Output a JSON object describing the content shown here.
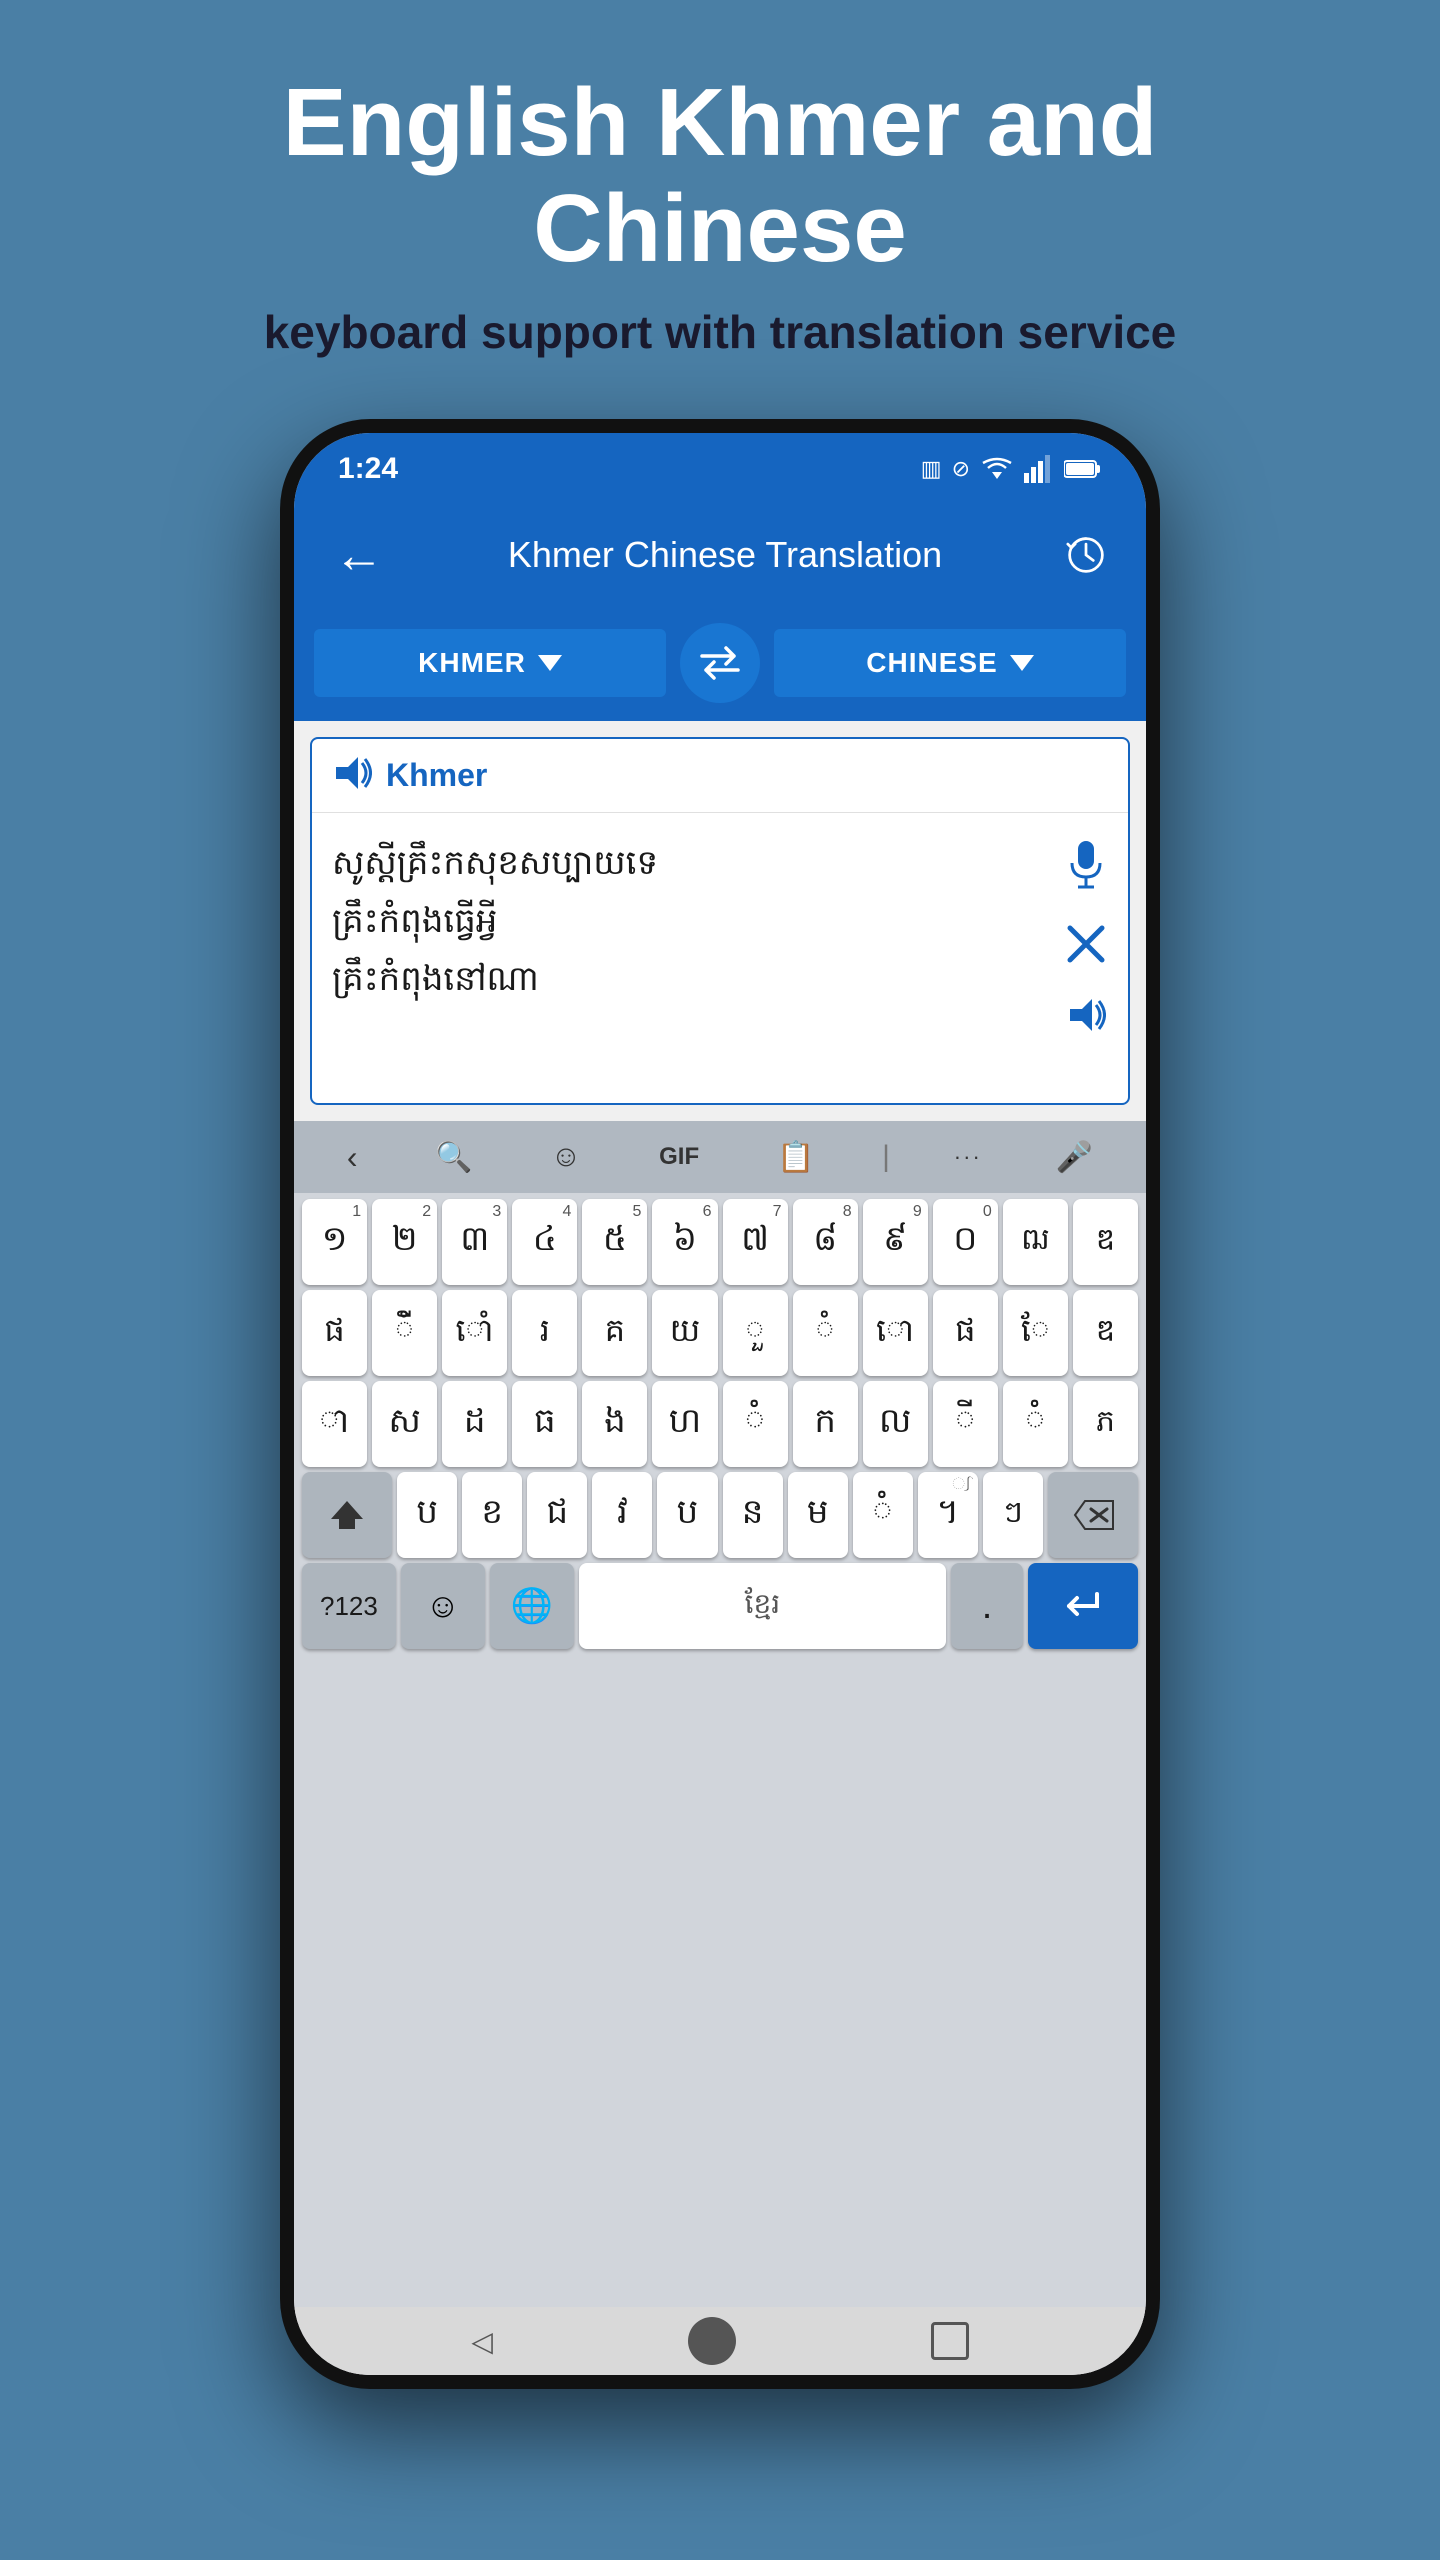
{
  "page": {
    "title": "English Khmer and Chinese",
    "subtitle": "keyboard support with translation service",
    "background_color": "#4a7fa5"
  },
  "status_bar": {
    "time": "1:24",
    "icons": [
      "sim-icon",
      "no-disturb-icon",
      "wifi-icon",
      "signal-icon",
      "battery-icon"
    ]
  },
  "app_bar": {
    "title": "Khmer Chinese Translation",
    "back_label": "←",
    "history_label": "⊙"
  },
  "lang_selector": {
    "source_lang": "KHMER",
    "target_lang": "CHINESE",
    "swap_icon": "⇄"
  },
  "translation_panel": {
    "source_lang_label": "Khmer",
    "source_text": "សូស្តីគ្រឹះកសុខសប្បាយទេ\nគ្រឹះកំពុងធ្វើអ្វី\nគ្រឹះកំពុងនៅណា",
    "icons": {
      "mic": "🎤",
      "clear": "✕",
      "speaker": "🔊"
    }
  },
  "keyboard": {
    "toolbar_items": [
      "‹",
      "🔍",
      "☺",
      "GIF",
      "📋",
      "···",
      "🎤"
    ],
    "row1": [
      {
        "char": "១",
        "num": "1"
      },
      {
        "char": "២",
        "num": "2"
      },
      {
        "char": "៣",
        "num": "3"
      },
      {
        "char": "៤",
        "num": "4"
      },
      {
        "char": "៥",
        "num": "5"
      },
      {
        "char": "៦",
        "num": "6"
      },
      {
        "char": "៧",
        "num": "7"
      },
      {
        "char": "៨",
        "num": "8"
      },
      {
        "char": "៩",
        "num": "9"
      },
      {
        "char": "០",
        "num": "0"
      },
      {
        "char": "ឍ",
        "num": ""
      },
      {
        "char": "ឌ",
        "num": ""
      }
    ],
    "row2": [
      {
        "char": "ផ"
      },
      {
        "char": "ីំ"
      },
      {
        "char": "ោំ"
      },
      {
        "char": "រ"
      },
      {
        "char": "គ"
      },
      {
        "char": "យ"
      },
      {
        "char": "ួំ"
      },
      {
        "char": "ំ"
      },
      {
        "char": "ោ"
      },
      {
        "char": "ផ"
      },
      {
        "char": "ែ"
      },
      {
        "char": "ឌ"
      }
    ],
    "row3": [
      {
        "char": "ា"
      },
      {
        "char": "ស"
      },
      {
        "char": "ដ"
      },
      {
        "char": "ធ"
      },
      {
        "char": "ង"
      },
      {
        "char": "ហ"
      },
      {
        "char": "ំ"
      },
      {
        "char": "ក"
      },
      {
        "char": "ល"
      },
      {
        "char": "ីំ"
      },
      {
        "char": "ំ"
      },
      {
        "char": "ភ"
      }
    ],
    "row4": [
      {
        "char": "⇧",
        "special": true
      },
      {
        "char": "ប"
      },
      {
        "char": "ខ"
      },
      {
        "char": "ជ"
      },
      {
        "char": "វ"
      },
      {
        "char": "ប"
      },
      {
        "char": "ន"
      },
      {
        "char": "ម"
      },
      {
        "char": "ំ"
      },
      {
        "char": "។"
      },
      {
        "char": "ៗ",
        "top": "ᨠ"
      },
      {
        "char": "⌫",
        "special": true
      }
    ],
    "bottom_row": {
      "num123": "?123",
      "emoji": "😊",
      "globe": "🌐",
      "space_label": "ខ្មែរ",
      "period": ".",
      "enter": "↵"
    }
  },
  "nav_bar": {
    "back_icon": "◁",
    "home_indicator": "●",
    "recents_icon": "▭"
  }
}
